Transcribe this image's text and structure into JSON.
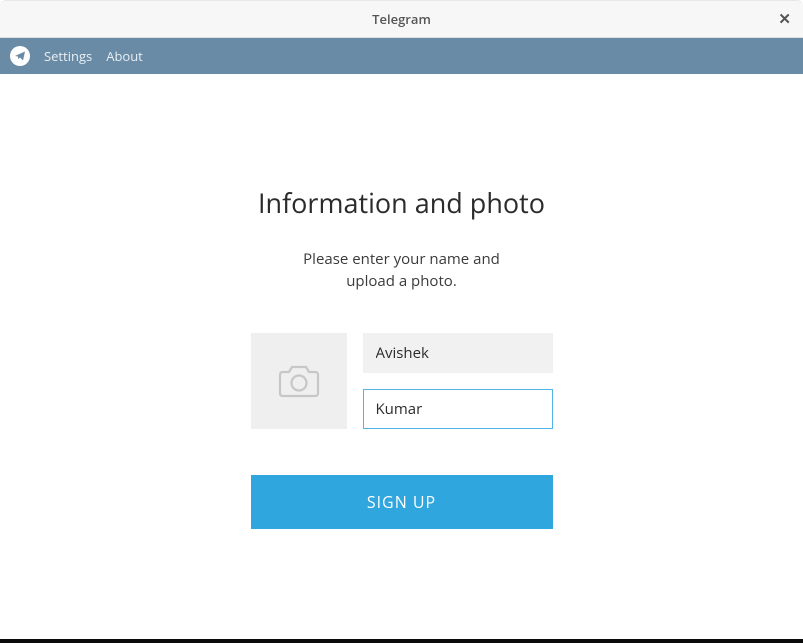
{
  "titlebar": {
    "title": "Telegram",
    "close": "✕"
  },
  "menubar": {
    "items": [
      "Settings",
      "About"
    ]
  },
  "page": {
    "heading": "Information and photo",
    "subtext_line1": "Please enter your name and",
    "subtext_line2": "upload a photo."
  },
  "form": {
    "first_name": "Avishek",
    "last_name": "Kumar"
  },
  "actions": {
    "signup": "SIGN UP"
  }
}
